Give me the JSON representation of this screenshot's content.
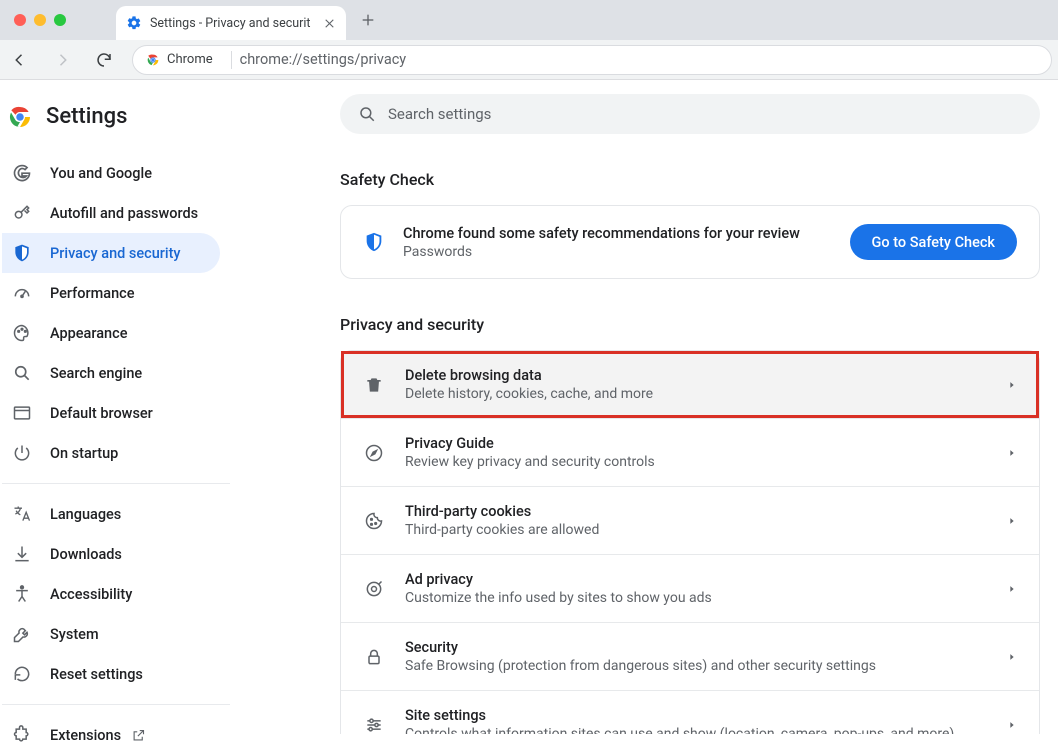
{
  "window": {
    "tab_title": "Settings - Privacy and securit",
    "chip_label": "Chrome",
    "url": "chrome://settings/privacy"
  },
  "brand": {
    "title": "Settings"
  },
  "search": {
    "placeholder": "Search settings"
  },
  "sidebar": {
    "items": [
      {
        "label": "You and Google"
      },
      {
        "label": "Autofill and passwords"
      },
      {
        "label": "Privacy and security"
      },
      {
        "label": "Performance"
      },
      {
        "label": "Appearance"
      },
      {
        "label": "Search engine"
      },
      {
        "label": "Default browser"
      },
      {
        "label": "On startup"
      }
    ],
    "secondary": [
      {
        "label": "Languages"
      },
      {
        "label": "Downloads"
      },
      {
        "label": "Accessibility"
      },
      {
        "label": "System"
      },
      {
        "label": "Reset settings"
      }
    ],
    "extensions_label": "Extensions"
  },
  "sections": {
    "safety_check": {
      "heading": "Safety Check",
      "line1": "Chrome found some safety recommendations for your review",
      "line2": "Passwords",
      "button": "Go to Safety Check"
    },
    "privacy": {
      "heading": "Privacy and security",
      "rows": [
        {
          "title": "Delete browsing data",
          "sub": "Delete history, cookies, cache, and more"
        },
        {
          "title": "Privacy Guide",
          "sub": "Review key privacy and security controls"
        },
        {
          "title": "Third-party cookies",
          "sub": "Third-party cookies are allowed"
        },
        {
          "title": "Ad privacy",
          "sub": "Customize the info used by sites to show you ads"
        },
        {
          "title": "Security",
          "sub": "Safe Browsing (protection from dangerous sites) and other security settings"
        },
        {
          "title": "Site settings",
          "sub": "Controls what information sites can use and show (location, camera, pop-ups, and more)"
        }
      ]
    }
  }
}
